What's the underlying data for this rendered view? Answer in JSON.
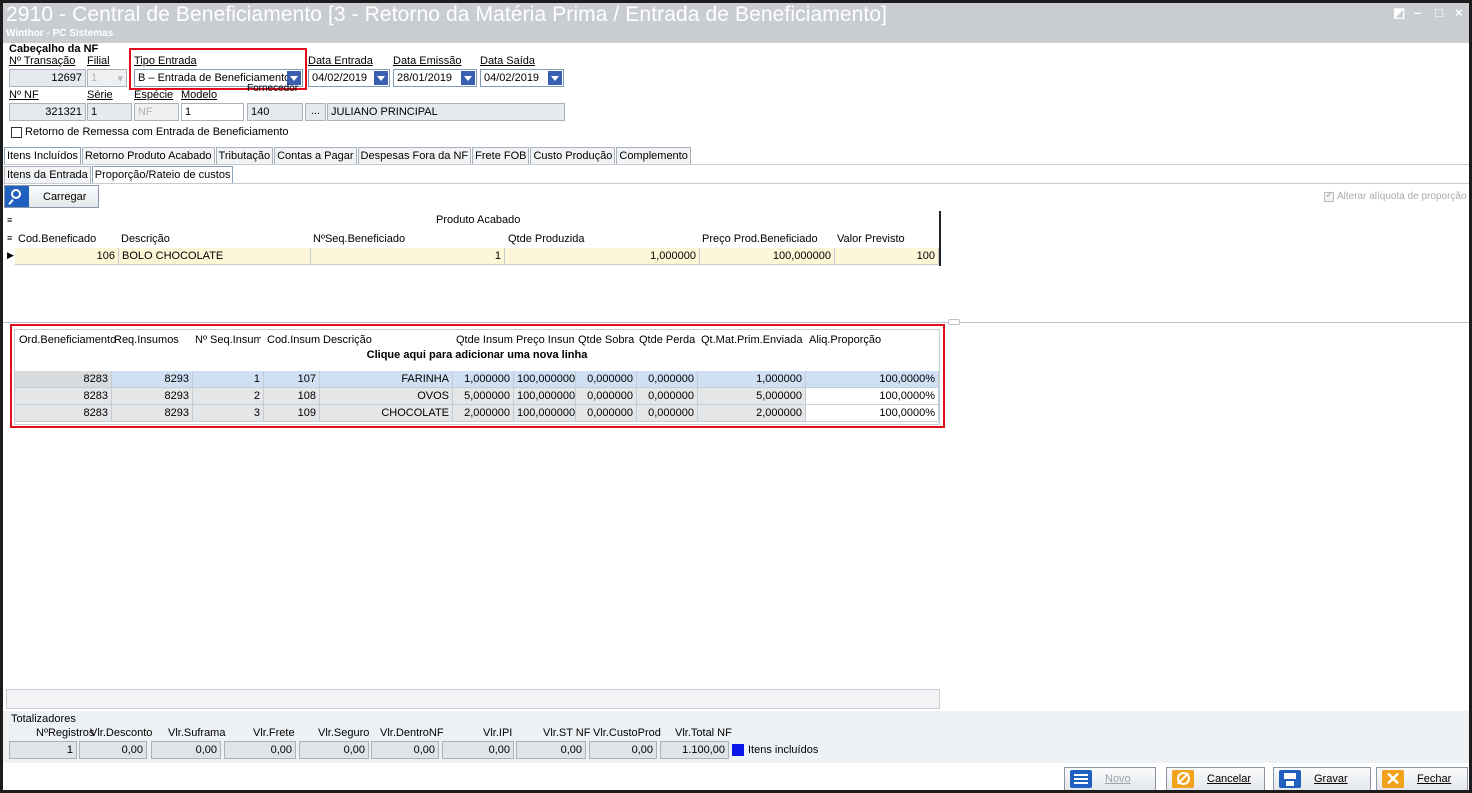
{
  "window": {
    "title": "2910 - Central de Beneficiamento [3 - Retorno da Matéria Prima / Entrada de Beneficiamento]",
    "subtitle": "Winthor - PC Sistemas",
    "minimize_glyph": "–",
    "maximize_glyph": "□",
    "close_glyph": "×"
  },
  "header": {
    "section_title": "Cabeçalho da NF",
    "n_transacao_label": "Nº Transação",
    "n_transacao_value": "12697",
    "filial_label": "Filial",
    "filial_value": "1",
    "tipo_entrada_label": "Tipo Entrada",
    "tipo_entrada_value": "B – Entrada de Beneficiamento",
    "data_entrada_label": "Data Entrada",
    "data_entrada_value": "04/02/2019",
    "data_emissao_label": "Data Emissão",
    "data_emissao_value": "28/01/2019",
    "data_saida_label": "Data Saída",
    "data_saida_value": "04/02/2019",
    "n_nf_label": "Nº NF",
    "n_nf_value": "321321",
    "serie_label": "Série",
    "serie_value": "1",
    "especie_label": "Espécie",
    "especie_value": "NF",
    "modelo_label": "Modelo",
    "modelo_value": "1",
    "fornecedor_label": "Fornecedor",
    "fornecedor_code": "140",
    "fornecedor_btn": "...",
    "fornecedor_name": "JULIANO PRINCIPAL",
    "retorno_checkbox_label": "Retorno de Remessa com Entrada de Beneficiamento"
  },
  "tabs": [
    "Itens Incluídos",
    "Retorno Produto Acabado",
    "Tributação",
    "Contas a Pagar",
    "Despesas Fora da NF",
    "Frete FOB",
    "Custo Produção",
    "Complemento"
  ],
  "subtabs": [
    "Itens da Entrada",
    "Proporção/Rateio de custos"
  ],
  "toolbar": {
    "carregar_label": "Carregar",
    "alterar_label": "Alterar alíquota de proporção"
  },
  "produto_grid": {
    "band_title": "Produto Acabado",
    "columns": [
      "Cod.Beneficado",
      "Descrição",
      "NºSeq.Beneficiado",
      "Qtde Produzida",
      "Preço Prod.Beneficiado",
      "Valor Previsto"
    ],
    "rows": [
      [
        "106",
        "BOLO CHOCOLATE",
        "1",
        "1,000000",
        "100,000000",
        "100"
      ]
    ]
  },
  "insumos_grid": {
    "columns": [
      "Ord.Beneficiamento",
      "Req.Insumos",
      "Nº Seq.Insumo",
      "Cod.Insumo",
      "Descrição",
      "Qtde Insumo",
      "Preço Insumo",
      "Qtde Sobra",
      "Qtde Perda",
      "Qt.Mat.Prim.Enviada",
      "Aliq.Proporção"
    ],
    "add_row_text": "Clique aqui para adicionar uma nova linha",
    "rows": [
      [
        "8283",
        "8293",
        "1",
        "107",
        "FARINHA",
        "1,000000",
        "100,000000",
        "0,000000",
        "0,000000",
        "1,000000",
        "100,0000%"
      ],
      [
        "8283",
        "8293",
        "2",
        "108",
        "OVOS",
        "5,000000",
        "100,000000",
        "0,000000",
        "0,000000",
        "5,000000",
        "100,0000%"
      ],
      [
        "8283",
        "8293",
        "3",
        "109",
        "CHOCOLATE",
        "2,000000",
        "100,000000",
        "0,000000",
        "0,000000",
        "2,000000",
        "100,0000%"
      ]
    ]
  },
  "totalizadores": {
    "title": "Totalizadores",
    "labels": [
      "NºRegistros",
      "Vlr.Desconto",
      "Vlr.Suframa",
      "Vlr.Frete",
      "Vlr.Seguro",
      "Vlr.DentroNF",
      "Vlr.IPI",
      "Vlr.ST NF",
      "Vlr.CustoProd",
      "Vlr.Total NF"
    ],
    "values": [
      "1",
      "0,00",
      "0,00",
      "0,00",
      "0,00",
      "0,00",
      "0,00",
      "0,00",
      "0,00",
      "1.100,00"
    ],
    "legend_label": "Itens incluídos",
    "legend_color": "#0a17e8"
  },
  "footer": {
    "novo": "Novo",
    "cancelar": "Cancelar",
    "gravar": "Gravar",
    "fechar": "Fechar"
  },
  "colors": {
    "highlight_box": "#e00d1a",
    "selected_row": "#cfe0f3",
    "product_row": "#fdf7d8"
  }
}
